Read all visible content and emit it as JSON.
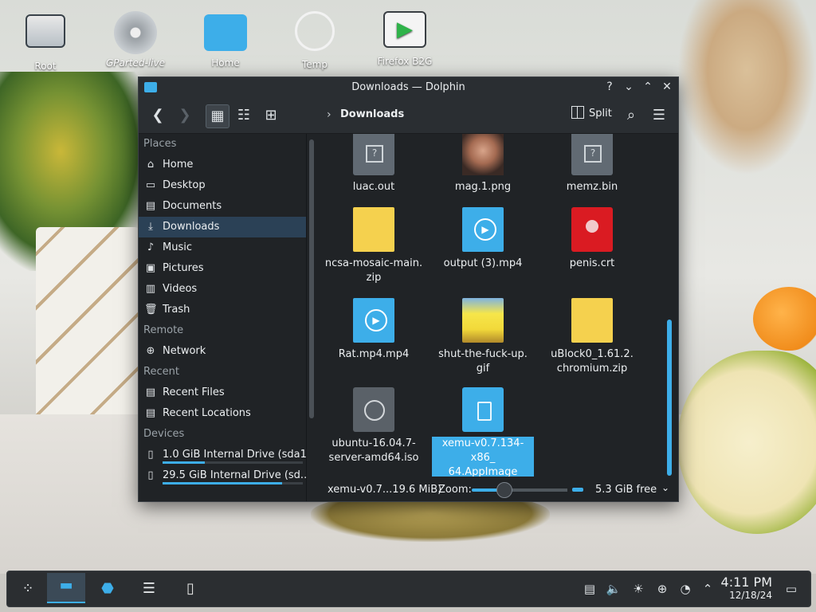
{
  "desktop": {
    "icons": [
      {
        "label": "Root"
      },
      {
        "label": "GParted-live"
      },
      {
        "label": "Home"
      },
      {
        "label": "Temp"
      },
      {
        "label": "Firefox B2G"
      }
    ]
  },
  "window": {
    "title": "Downloads — Dolphin",
    "controls": {
      "help": "?",
      "minimize": "⌄",
      "maximize": "⌃",
      "close": "✕"
    }
  },
  "toolbar": {
    "back": "❮",
    "forward": "❯",
    "view_icons": "▦",
    "view_compact": "☷",
    "view_details": "⊞",
    "breadcrumb_sep": "›",
    "breadcrumb": "Downloads",
    "split_label": "Split",
    "search": "⌕",
    "menu": "☰"
  },
  "sidebar": {
    "sections": [
      {
        "title": "Places",
        "items": [
          {
            "label": "Home",
            "icon": "⌂",
            "active": false
          },
          {
            "label": "Desktop",
            "icon": "▭",
            "active": false
          },
          {
            "label": "Documents",
            "icon": "▤",
            "active": false
          },
          {
            "label": "Downloads",
            "icon": "⤓",
            "active": true
          },
          {
            "label": "Music",
            "icon": "♪",
            "active": false
          },
          {
            "label": "Pictures",
            "icon": "▣",
            "active": false
          },
          {
            "label": "Videos",
            "icon": "▥",
            "active": false
          },
          {
            "label": "Trash",
            "icon": "🗑",
            "active": false
          }
        ]
      },
      {
        "title": "Remote",
        "items": [
          {
            "label": "Network",
            "icon": "⊕",
            "active": false
          }
        ]
      },
      {
        "title": "Recent",
        "items": [
          {
            "label": "Recent Files",
            "icon": "▤",
            "active": false
          },
          {
            "label": "Recent Locations",
            "icon": "▤",
            "active": false
          }
        ]
      },
      {
        "title": "Devices",
        "items": [
          {
            "label": "1.0 GiB Internal Drive (sda1)",
            "icon": "▯",
            "usage": 0.3
          },
          {
            "label": "29.5 GiB Internal Drive (sd...",
            "icon": "▯",
            "usage": 0.85
          }
        ]
      }
    ]
  },
  "files": [
    {
      "name": "luac.out",
      "type": "doc-grey",
      "selected": false
    },
    {
      "name": "mag.1.png",
      "type": "photo",
      "selected": false
    },
    {
      "name": "memz.bin",
      "type": "doc-grey",
      "selected": false
    },
    {
      "name": "ncsa-mosaic-main.\nzip",
      "type": "zip",
      "selected": false
    },
    {
      "name": "output (3).mp4",
      "type": "vid",
      "selected": false
    },
    {
      "name": "penis.crt",
      "type": "crt",
      "selected": false
    },
    {
      "name": "Rat.mp4.mp4",
      "type": "vid",
      "selected": false
    },
    {
      "name": "shut-the-fuck-up.\ngif",
      "type": "meme",
      "selected": false
    },
    {
      "name": "uBlock0_1.61.2.\nchromium.zip",
      "type": "zip",
      "selected": false
    },
    {
      "name": "ubuntu-16.04.7-\nserver-amd64.iso",
      "type": "iso",
      "selected": false
    },
    {
      "name": "xemu-v0.7.134-x86_\n64.AppImage",
      "type": "app",
      "selected": true
    }
  ],
  "status": {
    "selection": "xemu-v0.7...19.6 MiB)",
    "zoom_label": "Zoom:",
    "zoom_level": 0.33,
    "free_space": "5.3 GiB free",
    "chevron": "⌄"
  },
  "taskbar": {
    "launcher": "⁘",
    "apps": [
      {
        "name": "dolphin",
        "glyph": "▬",
        "active": true
      },
      {
        "name": "discover",
        "glyph": "⬣",
        "active": false
      },
      {
        "name": "system-settings",
        "glyph": "☰",
        "active": false
      },
      {
        "name": "document",
        "glyph": "▯",
        "active": false
      }
    ],
    "tray": {
      "clipboard": "▤",
      "volume": "🔈",
      "brightness": "☀",
      "network": "⊕",
      "updates": "◔",
      "expand": "⌃",
      "show_desktop": "▭"
    },
    "time": "4:11 PM",
    "date": "12/18/24"
  }
}
